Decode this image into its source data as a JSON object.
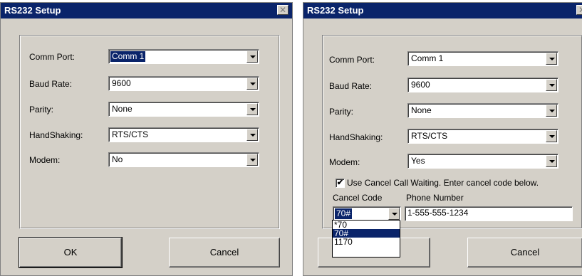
{
  "left_dialog": {
    "title": "RS232 Setup",
    "close_glyph": "✕",
    "fields": [
      {
        "label": "Comm Port:",
        "value": "Comm 1"
      },
      {
        "label": "Baud Rate:",
        "value": "9600"
      },
      {
        "label": "Parity:",
        "value": "None"
      },
      {
        "label": "HandShaking:",
        "value": "RTS/CTS"
      },
      {
        "label": "Modem:",
        "value": "No"
      }
    ],
    "ok_label": "OK",
    "cancel_label": "Cancel"
  },
  "right_dialog": {
    "title": "RS232 Setup",
    "close_glyph": "✕",
    "fields": [
      {
        "label": "Comm Port:",
        "value": "Comm 1"
      },
      {
        "label": "Baud Rate:",
        "value": "9600"
      },
      {
        "label": "Parity:",
        "value": "None"
      },
      {
        "label": "HandShaking:",
        "value": "RTS/CTS"
      },
      {
        "label": "Modem:",
        "value": "Yes"
      }
    ],
    "cancel_call_waiting": {
      "checked": true,
      "check_glyph": "✔",
      "label": "Use Cancel Call Waiting. Enter cancel code below."
    },
    "cancel_code": {
      "label": "Cancel Code",
      "value": "70#",
      "options": [
        "*70",
        "70#",
        "1170"
      ],
      "highlighted_option": "70#"
    },
    "phone_number": {
      "label": "Phone Number",
      "value": "1-555-555-1234"
    },
    "cancel_label": "Cancel"
  },
  "colors": {
    "titlebar": "#0a246a",
    "dialog_face": "#d4d0c8",
    "selection": "#0a246a"
  }
}
